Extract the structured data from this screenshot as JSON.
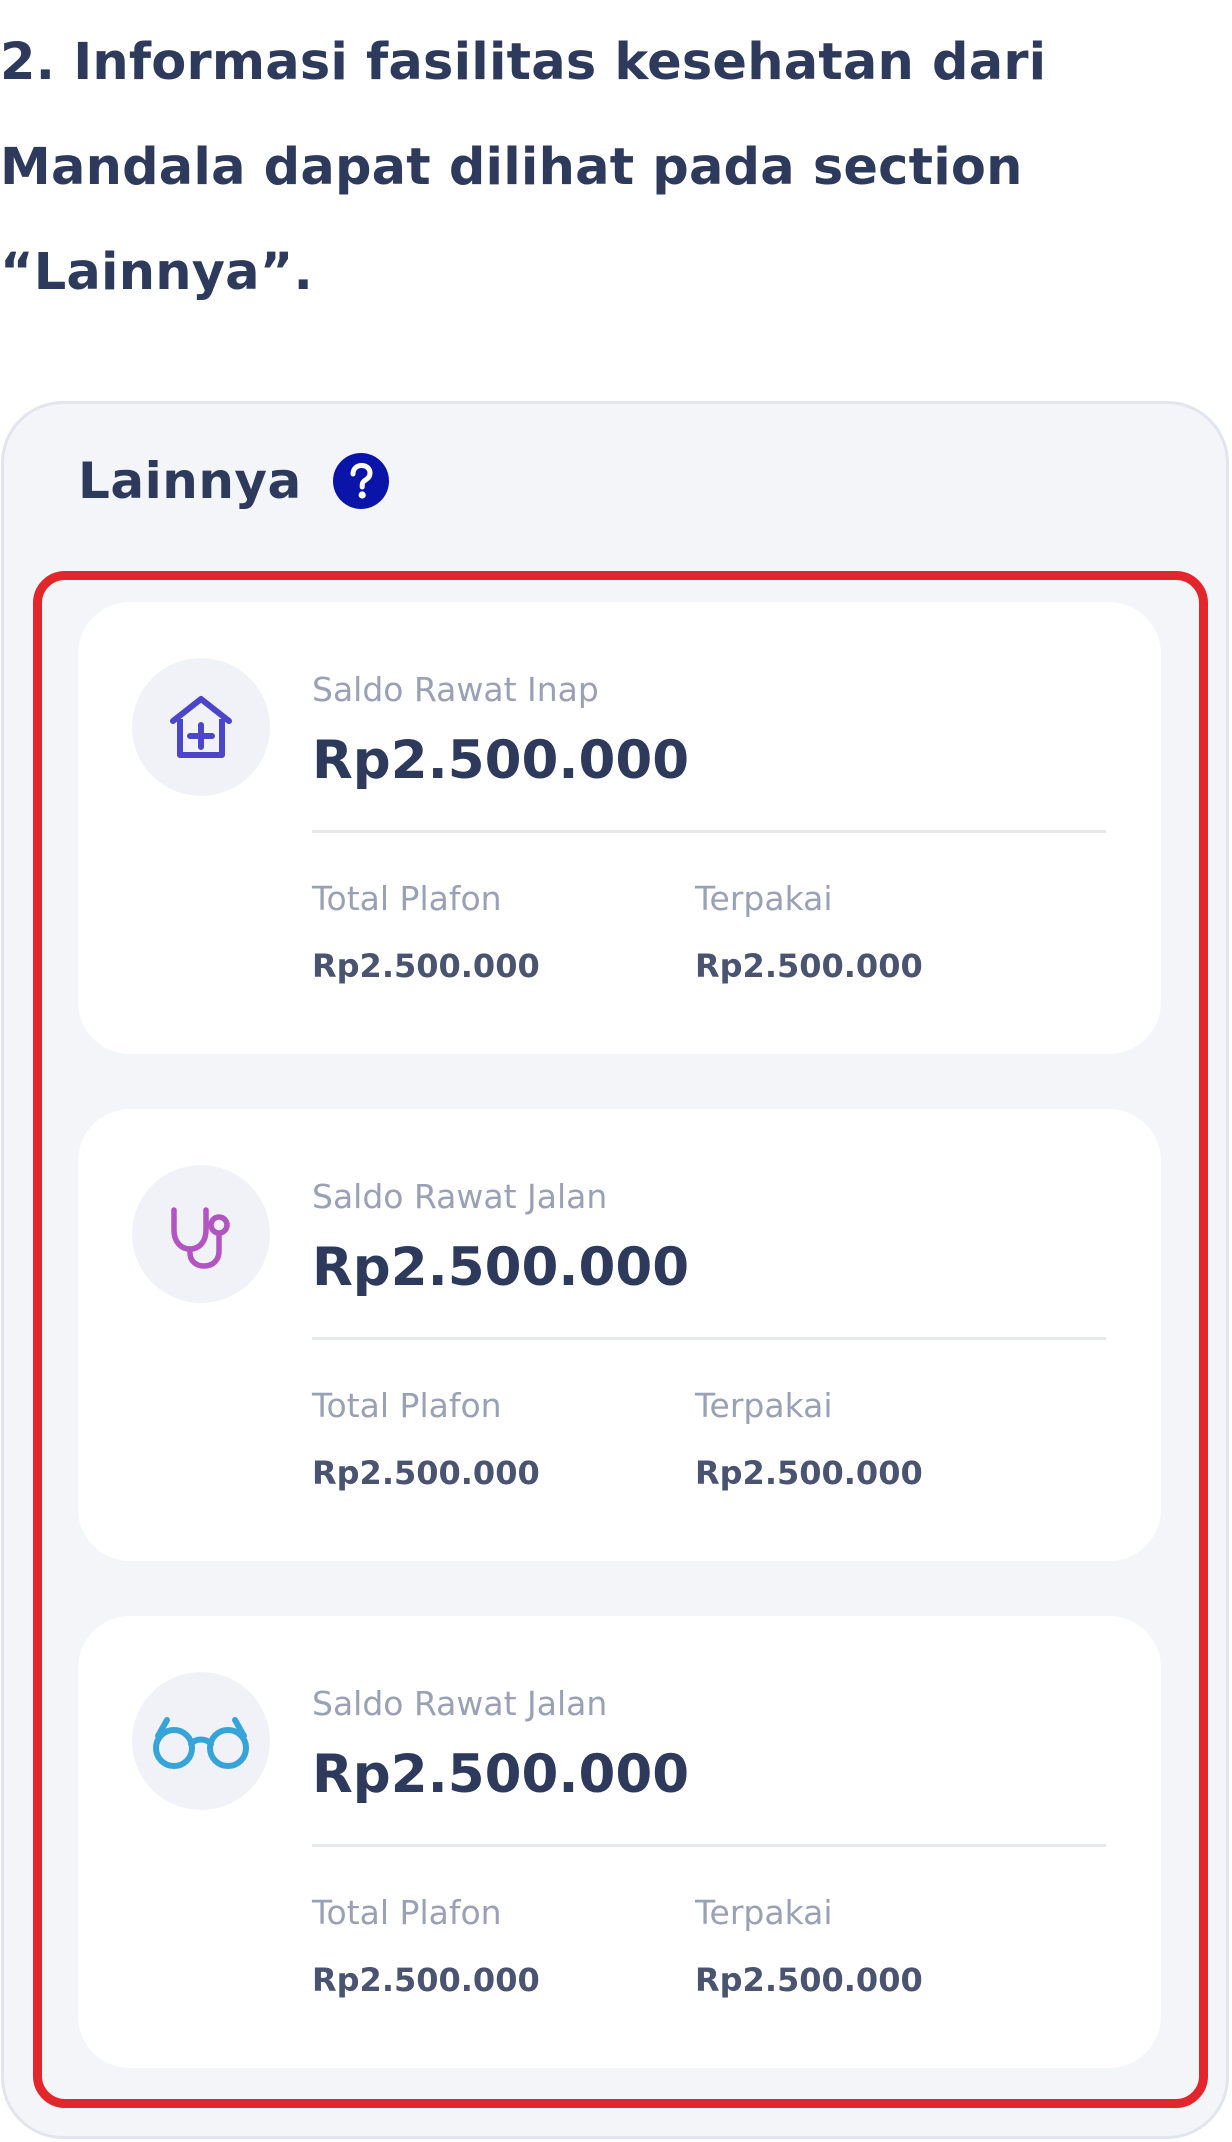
{
  "instruction": {
    "text": "2. Informasi fasilitas kesehatan dari Mandala dapat dilihat pada section “Lainnya”."
  },
  "section": {
    "title": "Lainnya",
    "help_icon": "question-circle-icon"
  },
  "colors": {
    "heading": "#2d3a5c",
    "help_icon": "#0a14a8",
    "highlight_border": "#e3262b",
    "panel_bg": "#f4f5f9",
    "card_bg": "#ffffff",
    "muted_text": "#9aa1b5",
    "hospital_icon": "#4b45c9",
    "stethoscope_icon": "#b254c2",
    "glasses_icon": "#36a4d8"
  },
  "cards": [
    {
      "icon": "hospital-icon",
      "label": "Saldo Rawat Inap",
      "value": "Rp2.500.000",
      "total_plafon_label": "Total Plafon",
      "total_plafon_value": "Rp2.500.000",
      "terpakai_label": "Terpakai",
      "terpakai_value": "Rp2.500.000"
    },
    {
      "icon": "stethoscope-icon",
      "label": "Saldo Rawat Jalan",
      "value": "Rp2.500.000",
      "total_plafon_label": "Total Plafon",
      "total_plafon_value": "Rp2.500.000",
      "terpakai_label": "Terpakai",
      "terpakai_value": "Rp2.500.000"
    },
    {
      "icon": "glasses-icon",
      "label": "Saldo Rawat Jalan",
      "value": "Rp2.500.000",
      "total_plafon_label": "Total Plafon",
      "total_plafon_value": "Rp2.500.000",
      "terpakai_label": "Terpakai",
      "terpakai_value": "Rp2.500.000"
    }
  ]
}
